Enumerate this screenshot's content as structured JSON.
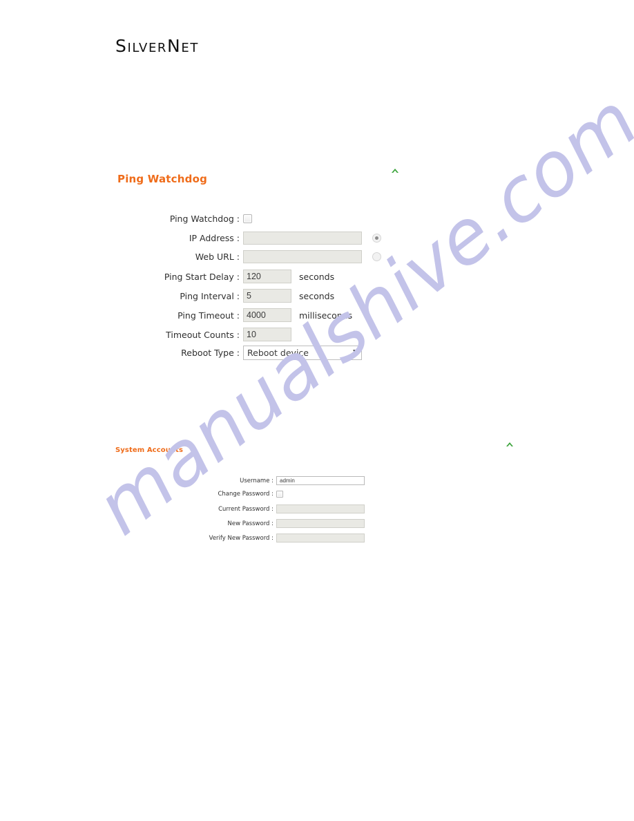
{
  "brand": {
    "name": "SilverNet",
    "part1": "S",
    "part2": "ILVER",
    "part3": "N",
    "part4": "ET"
  },
  "watermark": {
    "text": "manualshive.com",
    "color": "#c3c3e9"
  },
  "colors": {
    "section_heading": "#ef6c1a",
    "chevron": "#3aa33a",
    "label": "#2f2f2f",
    "field_disabled_bg": "#e9e9e4",
    "field_enabled_bg": "#ffffff"
  },
  "sections": {
    "ping_watchdog": {
      "title": "Ping Watchdog",
      "collapse_icon": "chevron-up-icon",
      "fields": {
        "enable": {
          "label": "Ping Watchdog :",
          "type": "checkbox",
          "checked": false
        },
        "ip_address": {
          "label": "IP Address :",
          "value": "",
          "radio_selected": true
        },
        "web_url": {
          "label": "Web URL :",
          "value": "",
          "radio_selected": false
        },
        "ping_start_delay": {
          "label": "Ping Start Delay :",
          "value": "120",
          "unit": "seconds"
        },
        "ping_interval": {
          "label": "Ping Interval :",
          "value": "5",
          "unit": "seconds"
        },
        "ping_timeout": {
          "label": "Ping Timeout :",
          "value": "4000",
          "unit": "milliseconds"
        },
        "timeout_counts": {
          "label": "Timeout Counts :",
          "value": "10",
          "unit": ""
        },
        "reboot_type": {
          "label": "Reboot Type :",
          "value": "Reboot device",
          "arrow": "▼"
        }
      }
    },
    "system_accounts": {
      "title": "System Accounts",
      "collapse_icon": "chevron-up-icon",
      "fields": {
        "username": {
          "label": "Username :",
          "value": "admin"
        },
        "change_password": {
          "label": "Change Password :",
          "type": "checkbox",
          "checked": false
        },
        "current_password": {
          "label": "Current Password :",
          "value": ""
        },
        "new_password": {
          "label": "New Password :",
          "value": ""
        },
        "verify_new_password": {
          "label": "Verify New Password :",
          "value": ""
        }
      }
    }
  }
}
